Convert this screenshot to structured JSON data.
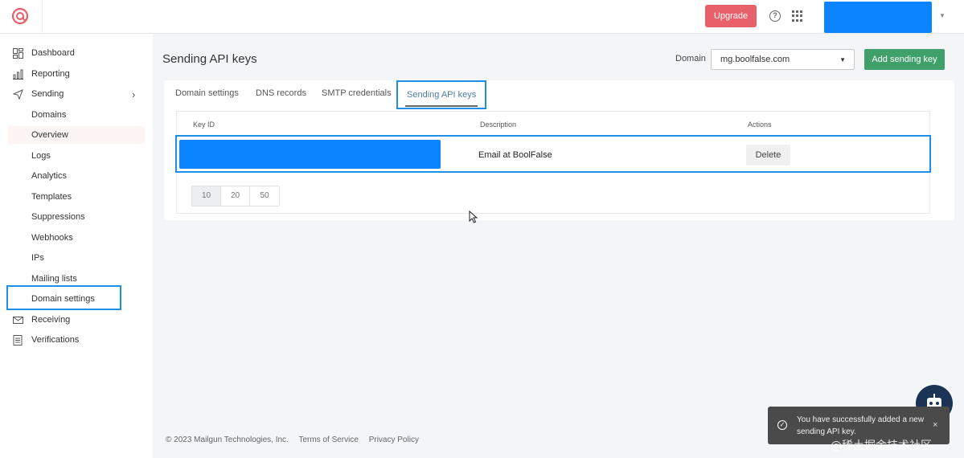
{
  "topbar": {
    "upgrade_label": "Upgrade",
    "help_icon": "?"
  },
  "sidebar": {
    "items": [
      {
        "label": "Dashboard",
        "icon": "dashboard-icon"
      },
      {
        "label": "Reporting",
        "icon": "reporting-icon"
      },
      {
        "label": "Sending",
        "icon": "send-icon",
        "expandable": true
      },
      {
        "label": "Domains"
      },
      {
        "label": "Overview",
        "active": true
      },
      {
        "label": "Logs"
      },
      {
        "label": "Analytics"
      },
      {
        "label": "Templates"
      },
      {
        "label": "Suppressions"
      },
      {
        "label": "Webhooks"
      },
      {
        "label": "IPs"
      },
      {
        "label": "Mailing lists"
      },
      {
        "label": "Domain settings",
        "highlighted": true
      },
      {
        "label": "Receiving",
        "icon": "mail-icon"
      },
      {
        "label": "Verifications",
        "icon": "list-icon"
      }
    ]
  },
  "main": {
    "title": "Sending API keys",
    "domain_label": "Domain",
    "domain_value": "mg.boolfalse.com",
    "add_button": "Add sending key",
    "tabs": [
      {
        "label": "Domain settings"
      },
      {
        "label": "DNS records"
      },
      {
        "label": "SMTP credentials"
      },
      {
        "label": "Sending API keys",
        "active": true
      }
    ],
    "table": {
      "headers": [
        "Key ID",
        "Description",
        "Actions"
      ],
      "rows": [
        {
          "key_id": "",
          "description": "Email at BoolFalse",
          "action": "Delete"
        }
      ]
    },
    "pager": [
      "10",
      "20",
      "50"
    ]
  },
  "footer": {
    "copyright": "© 2023 Mailgun Technologies, Inc.",
    "terms": "Terms of Service",
    "privacy": "Privacy Policy"
  },
  "toast": {
    "message": "You have successfully added a new sending API key.",
    "close": "×"
  },
  "watermark": "@稀土掘金技术社区",
  "colors": {
    "upgrade": "#e8606a",
    "add_button": "#3fa06a",
    "highlight": "#1e8ee6",
    "redaction": "#0a84ff"
  }
}
